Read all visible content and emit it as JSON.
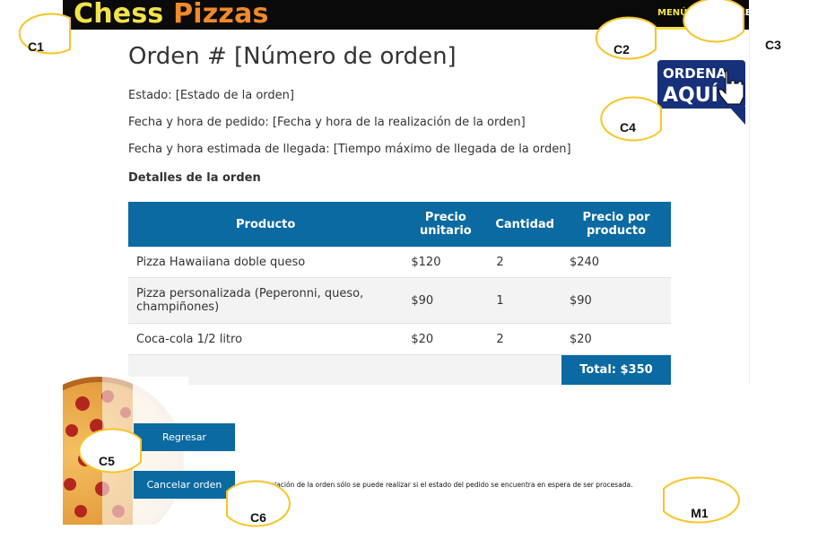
{
  "header": {
    "logo_word1": "Chess",
    "logo_word2": "Pizzas",
    "nav": [
      "MENÚ",
      "SUCURSALES"
    ]
  },
  "order": {
    "title": "Orden # [Número de orden]",
    "status": "Estado: [Estado de la orden]",
    "placed": "Fecha y hora de pedido: [Fecha y hora de la realización de la orden]",
    "eta": "Fecha y hora estimada de llegada: [Tiempo máximo de llegada de la orden]",
    "details_title": "Detalles de la orden"
  },
  "table": {
    "headers": [
      "Producto",
      "Precio unitario",
      "Cantidad",
      "Precio por producto"
    ],
    "rows": [
      [
        "Pizza Hawaiiana doble queso",
        "$120",
        "2",
        "$240"
      ],
      [
        "Pizza personalizada (Peperonni, queso, champiñones)",
        "$90",
        "1",
        "$90"
      ],
      [
        "Coca-cola 1/2 litro",
        "$20",
        "2",
        "$20"
      ]
    ],
    "total": "Total: $350"
  },
  "actions": {
    "back": "Regresar",
    "cancel": "Cancelar orden",
    "note": "*La cancelación de la orden sólo se puede realizar si el estado del pedido se encuentra en espera de ser procesada."
  },
  "promo": {
    "line1": "ORDENA",
    "line2": "AQUÍ"
  },
  "callouts": [
    "C1",
    "C2",
    "C3",
    "C4",
    "C5",
    "C6",
    "M1"
  ],
  "colors": {
    "brand_blue": "#0a6aa1",
    "logo_yellow": "#f3e34a",
    "logo_orange": "#f08a2a",
    "callout": "#f6c528"
  }
}
